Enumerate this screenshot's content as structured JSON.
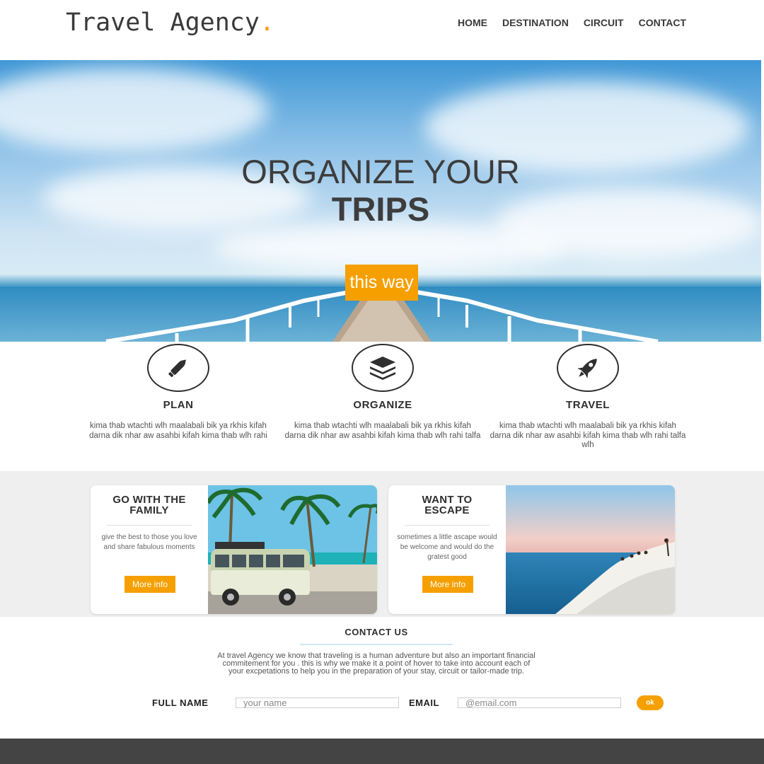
{
  "header": {
    "logo_text": "Travel Agency",
    "logo_dot": ".",
    "nav": [
      "HOME",
      "DESTINATION",
      "CIRCUIT",
      "CONTACT"
    ]
  },
  "hero": {
    "title_line1": "ORGANIZE YOUR",
    "title_line2": "TRIPS",
    "cta_label": "this way"
  },
  "features": [
    {
      "icon": "pen-icon",
      "title": "PLAN",
      "text": "kima thab wtachti wlh maalabali bik ya rkhis kifah darna dik nhar aw asahbi kifah kima thab wlh rahi"
    },
    {
      "icon": "layers-icon",
      "title": "ORGANIZE",
      "text": "kima thab wtachti wlh maalabali bik ya rkhis kifah darna dik nhar aw asahbi kifah kima thab wlh rahi talfa"
    },
    {
      "icon": "rocket-icon",
      "title": "TRAVEL",
      "text": "kima thab wtachti wlh maalabali bik ya rkhis kifah darna dik nhar aw asahbi kifah kima thab wlh rahi talfa wlh"
    }
  ],
  "cards": [
    {
      "title_line1": "GO WITH THE",
      "title_line2": "FAMILY",
      "text": "give the best to those you love and share fabulous moments",
      "button": "More info"
    },
    {
      "title_line1": "WANT TO",
      "title_line2": "ESCAPE",
      "text": "sometimes a little ascape would be welcome and would do the gratest good",
      "button": "More info"
    }
  ],
  "contact": {
    "title": "CONTACT US",
    "text": "At travel Agency we know that traveling is a human adventure but also an important financial commitement for you . this is why we make it a point of hover to take into account each of your excpetations to help you in the preparation of your stay, circuit or tailor-made trip.",
    "fullname_label": "FULL NAME",
    "fullname_placeholder": "your name",
    "email_label": "EMAIL",
    "email_placeholder": "@email.com",
    "submit_label": "ok"
  },
  "colors": {
    "accent": "#f5a000",
    "text_dark": "#3a3a3a",
    "footer": "#444444",
    "section_bg": "#efefef"
  }
}
